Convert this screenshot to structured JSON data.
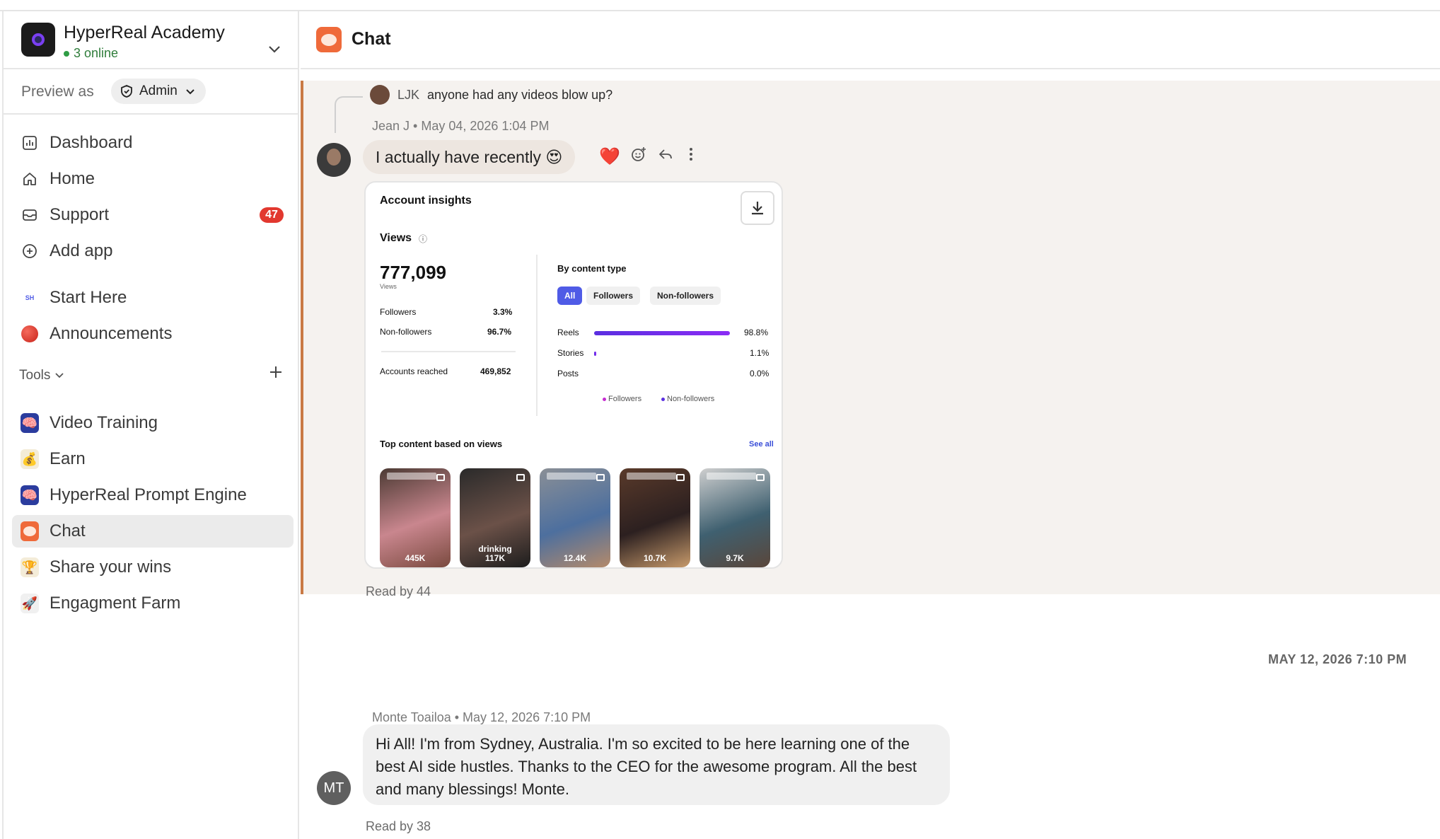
{
  "workspace": {
    "name": "HyperReal Academy",
    "online": "3 online"
  },
  "preview": {
    "label": "Preview as",
    "role": "Admin"
  },
  "nav": {
    "items": [
      {
        "label": "Dashboard"
      },
      {
        "label": "Home"
      },
      {
        "label": "Support",
        "badge": "47"
      },
      {
        "label": "Add app"
      },
      {
        "label": "Start Here",
        "icon_text": "SH"
      },
      {
        "label": "Announcements"
      }
    ],
    "tools_label": "Tools",
    "tools": [
      {
        "label": "Video Training"
      },
      {
        "label": "Earn"
      },
      {
        "label": "HyperReal Prompt Engine"
      },
      {
        "label": "Chat"
      },
      {
        "label": "Share your wins"
      },
      {
        "label": "Engagment Farm"
      }
    ]
  },
  "chat": {
    "title": "Chat",
    "reply": {
      "user": "LJK",
      "text": "anyone had any videos blow up?"
    },
    "message1": {
      "meta": "Jean J • May 04, 2026 1:04 PM",
      "text": "I actually have recently 😍",
      "read_by": "Read by 44"
    },
    "insights": {
      "title": "Account insights",
      "views_label": "Views",
      "views_value": "777,099",
      "views_sub": "Views",
      "followers_label": "Followers",
      "followers_value": "3.3%",
      "nonfollowers_label": "Non-followers",
      "nonfollowers_value": "96.7%",
      "reached_label": "Accounts reached",
      "reached_value": "469,852",
      "by_content": "By content type",
      "pills": [
        "All",
        "Followers",
        "Non-followers"
      ],
      "rows": [
        {
          "label": "Reels",
          "value": "98.8%",
          "fraction": 0.988
        },
        {
          "label": "Stories",
          "value": "1.1%",
          "fraction": 0.011
        },
        {
          "label": "Posts",
          "value": "0.0%",
          "fraction": 0.0
        }
      ],
      "legend": [
        "Followers",
        "Non-followers"
      ],
      "top_content": "Top content based on views",
      "see_all": "See all",
      "thumbs": [
        "445K",
        "drinking\n117K",
        "12.4K",
        "10.7K",
        "9.7K"
      ]
    },
    "day_separator": "MAY 12, 2026 7:10 PM",
    "message2": {
      "meta": "Monte Toailoa • May 12, 2026 7:10 PM",
      "avatar": "MT",
      "text": "Hi All! I'm from Sydney, Australia. I'm so excited to be here learning one of the best AI side hustles. Thanks to the CEO for the awesome program. All the best and many blessings! Monte.",
      "read_by": "Read by 38"
    }
  },
  "colors": {
    "accent": "#4f5be6",
    "badge": "#e2382f",
    "highlight_bar": "#c97a45"
  }
}
